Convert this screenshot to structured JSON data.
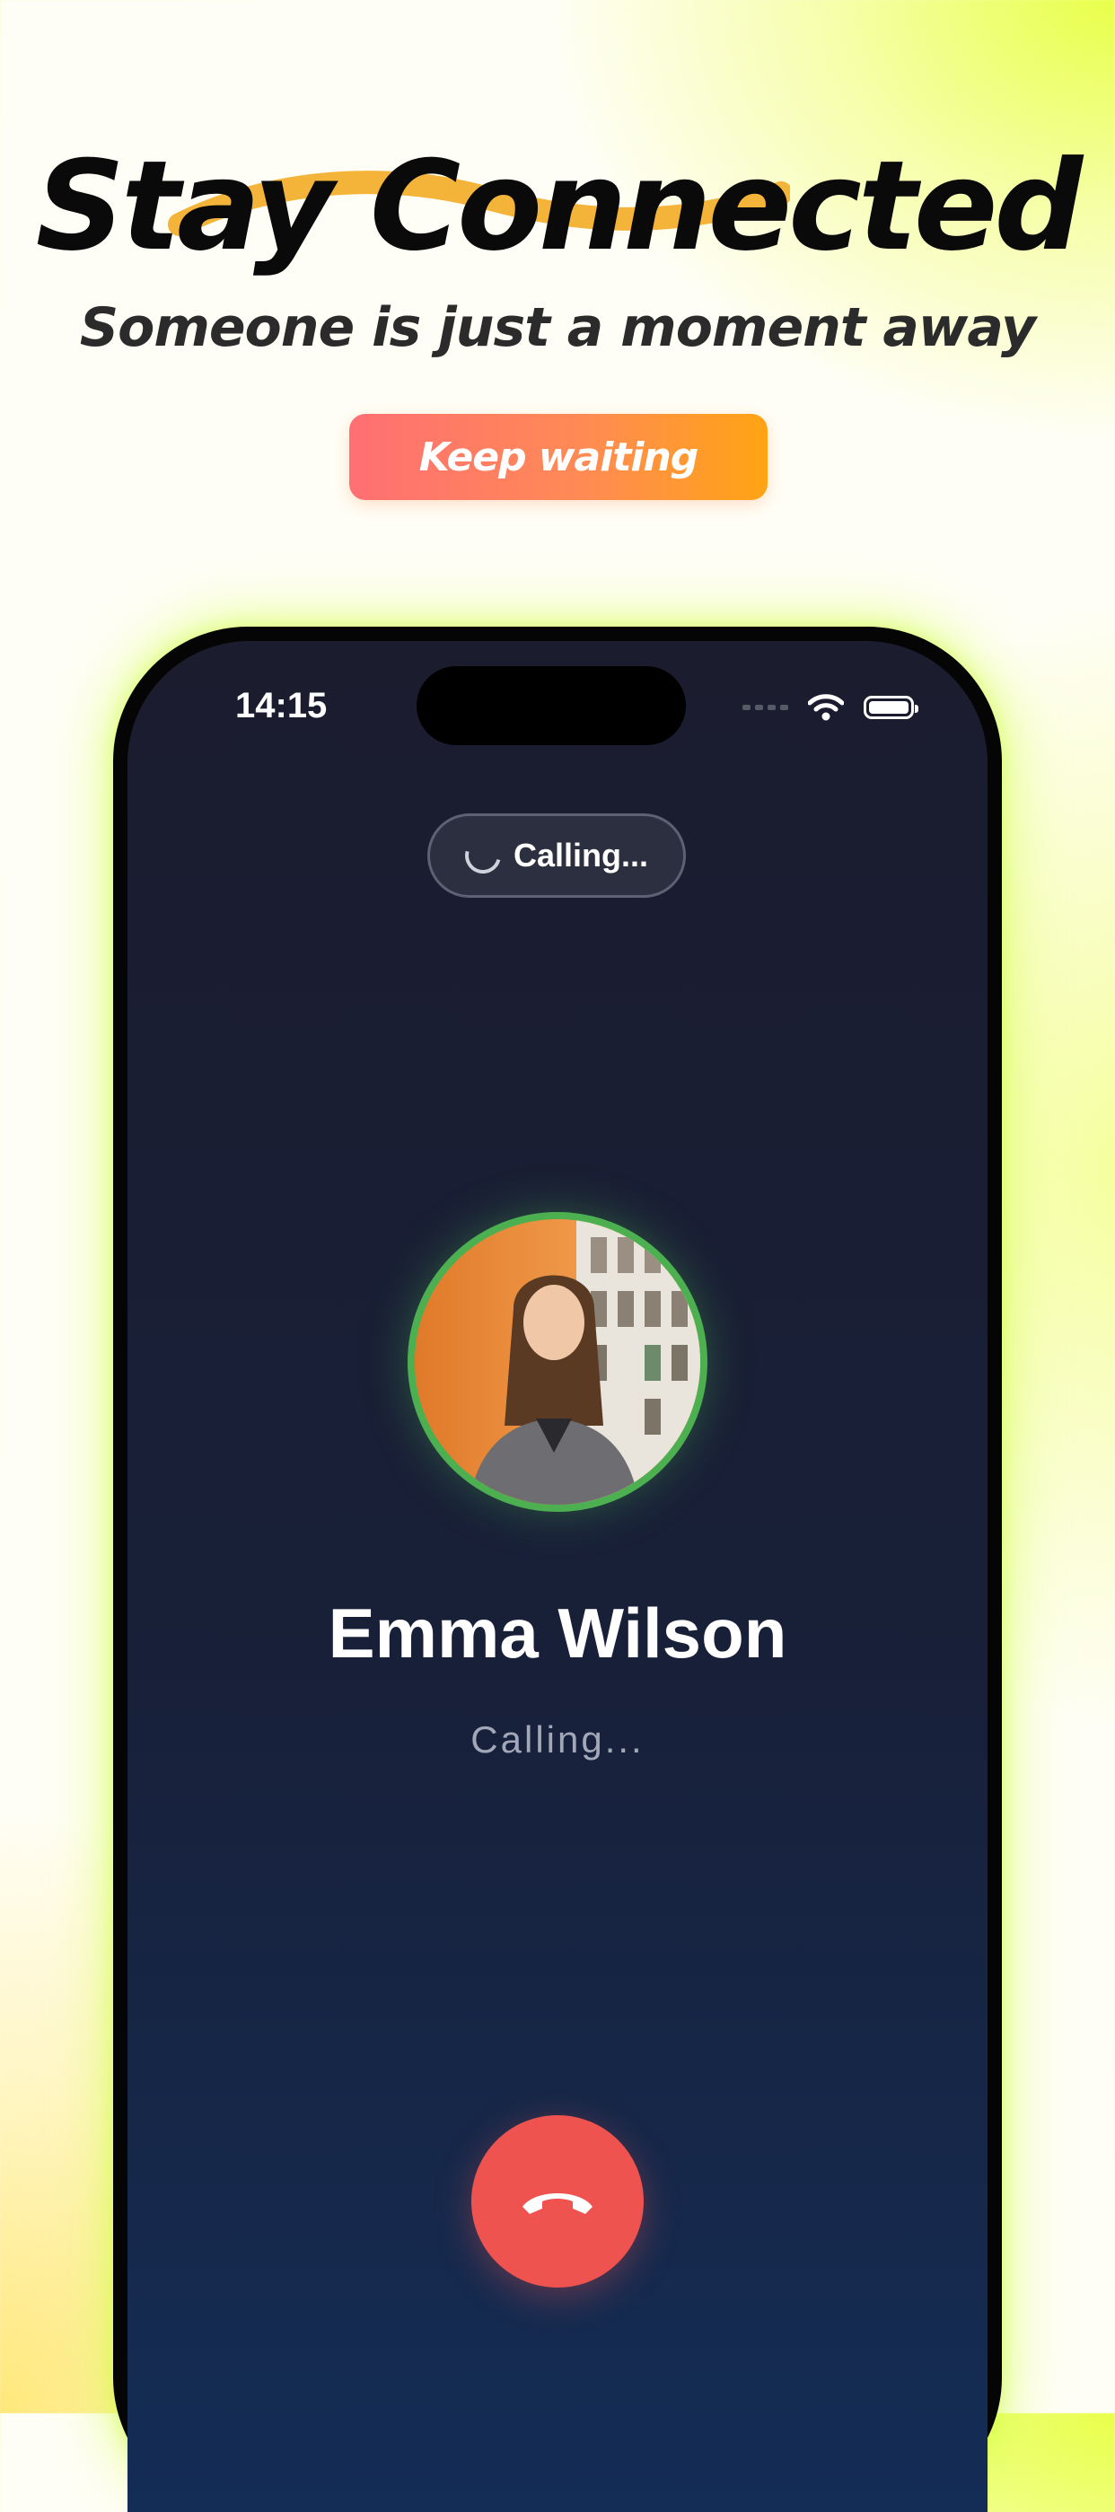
{
  "header": {
    "title": "Stay Connected",
    "subtitle": "Someone is just a moment away",
    "cta_label": "Keep waiting"
  },
  "status_bar": {
    "time": "14:15",
    "icons": [
      "signal-dots-icon",
      "wifi-icon",
      "battery-icon"
    ]
  },
  "call": {
    "pill_label": "Calling...",
    "contact_name": "Emma Wilson",
    "status_text": "Calling...",
    "end_call_icon": "phone-hangup-icon"
  },
  "colors": {
    "accent_gradient_start": "#ff6f73",
    "accent_gradient_end": "#ffa414",
    "avatar_ring": "#4caf50",
    "end_call": "#ef5350",
    "phone_glow": "#d2ff3c"
  }
}
